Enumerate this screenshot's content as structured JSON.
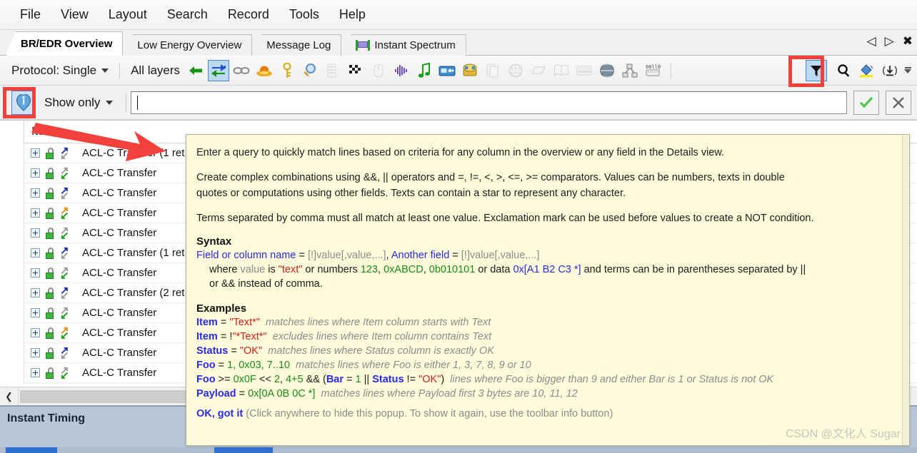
{
  "menu": {
    "items": [
      "File",
      "View",
      "Layout",
      "Search",
      "Record",
      "Tools",
      "Help"
    ]
  },
  "tabs": {
    "items": [
      {
        "label": "BR/EDR Overview",
        "active": true,
        "icon": ""
      },
      {
        "label": "Low Energy Overview",
        "active": false,
        "icon": ""
      },
      {
        "label": "Message Log",
        "active": false,
        "icon": ""
      },
      {
        "label": "Instant Spectrum",
        "active": false,
        "icon": "spectrum-icon"
      }
    ],
    "nav": {
      "prev": "◁",
      "next": "▷",
      "close": "✖"
    }
  },
  "toolbar": {
    "protocol_label": "Protocol: Single",
    "layers_label": "All layers",
    "icons": [
      {
        "name": "back-arrow-icon",
        "glyph": "←",
        "style": "green",
        "boxed": false,
        "dim": false
      },
      {
        "name": "bidirectional-arrow-icon",
        "glyph": "⇄",
        "style": "greenblue",
        "boxed": true,
        "dim": false
      },
      {
        "name": "link-chain-icon",
        "glyph": "⛓",
        "style": "gray",
        "boxed": false,
        "dim": false
      },
      {
        "name": "hat-icon",
        "glyph": "⬤",
        "style": "hat",
        "boxed": false,
        "dim": false
      },
      {
        "name": "key-icon",
        "glyph": "⚷",
        "style": "key",
        "boxed": false,
        "dim": false
      },
      {
        "name": "magnifier-icon",
        "glyph": "ὐd",
        "style": "magnifier",
        "boxed": false,
        "dim": false
      },
      {
        "name": "list-icon",
        "glyph": "☰",
        "style": "gray",
        "boxed": false,
        "dim": true
      },
      {
        "name": "checkered-flag-icon",
        "glyph": "⚑",
        "style": "flag",
        "boxed": false,
        "dim": false
      },
      {
        "name": "mouse-icon",
        "glyph": "⬭",
        "style": "gray",
        "boxed": false,
        "dim": true
      },
      {
        "name": "waveform-icon",
        "glyph": "✳",
        "style": "purple",
        "boxed": false,
        "dim": false
      },
      {
        "name": "music-note-icon",
        "glyph": "♫",
        "style": "greenmusic",
        "boxed": false,
        "dim": false
      },
      {
        "name": "radio-icon",
        "glyph": "▣",
        "style": "radio",
        "boxed": false,
        "dim": false
      },
      {
        "name": "phone-icon",
        "glyph": "☎",
        "style": "phone",
        "boxed": false,
        "dim": false
      },
      {
        "name": "copy-pages-icon",
        "glyph": "❐",
        "style": "gray",
        "boxed": false,
        "dim": true
      },
      {
        "name": "chip-icon",
        "glyph": "▦",
        "style": "gray",
        "boxed": false,
        "dim": true
      },
      {
        "name": "document-icon",
        "glyph": "▱",
        "style": "gray",
        "boxed": false,
        "dim": true
      },
      {
        "name": "book-icon",
        "glyph": "ὖe",
        "style": "gray",
        "boxed": false,
        "dim": true
      },
      {
        "name": "keyboard-icon",
        "glyph": "⌨",
        "style": "gray",
        "boxed": false,
        "dim": true
      },
      {
        "name": "globe-icon",
        "glyph": "ἱ0",
        "style": "globe",
        "boxed": false,
        "dim": false
      },
      {
        "name": "network-icon",
        "glyph": "⛭",
        "style": "gray",
        "boxed": false,
        "dim": false
      },
      {
        "name": "serial-port-icon",
        "glyph": "⌸",
        "style": "serial",
        "boxed": false,
        "dim": false
      }
    ],
    "right_icons": [
      {
        "name": "filter-funnel-icon",
        "glyph": "▽",
        "boxed": true
      },
      {
        "name": "search-icon",
        "glyph": "ὐd",
        "boxed": false
      },
      {
        "name": "paint-bucket-icon",
        "glyph": "◢",
        "boxed": false
      },
      {
        "name": "signal-download-icon",
        "glyph": "↓",
        "boxed": false
      }
    ]
  },
  "filterbar": {
    "info_icon": "info-circle-icon",
    "show_only_label": "Show only",
    "query_value": "",
    "query_placeholder": "",
    "apply_icon": "check-icon",
    "cancel_icon": "close-icon"
  },
  "tree": {
    "column_header": "Item",
    "rows": [
      {
        "label": "ACL-C Transfer (1 ret",
        "top": "blue",
        "bottom": "gray"
      },
      {
        "label": "ACL-C Transfer",
        "top": "gray",
        "bottom": "green"
      },
      {
        "label": "ACL-C Transfer",
        "top": "blue",
        "bottom": "gray"
      },
      {
        "label": "ACL-C Transfer",
        "top": "orange",
        "bottom": "green"
      },
      {
        "label": "ACL-C Transfer",
        "top": "gray",
        "bottom": "green"
      },
      {
        "label": "ACL-C Transfer (1 ret",
        "top": "blue",
        "bottom": "gray"
      },
      {
        "label": "ACL-C Transfer",
        "top": "gray",
        "bottom": "green"
      },
      {
        "label": "ACL-C Transfer (2 ret",
        "top": "blue",
        "bottom": "gray"
      },
      {
        "label": "ACL-C Transfer",
        "top": "gray",
        "bottom": "green"
      },
      {
        "label": "ACL-C Transfer",
        "top": "orange",
        "bottom": "green"
      },
      {
        "label": "ACL-C Transfer",
        "top": "blue",
        "bottom": "gray"
      },
      {
        "label": "ACL-C Transfer",
        "top": "gray",
        "bottom": "green"
      }
    ],
    "hscroll_left_icon": "chevron-left-icon"
  },
  "bottom_panel": {
    "title": "Instant Timing"
  },
  "popup": {
    "para1": "Enter a query to quickly match lines based on criteria for any column in the overview or any field in the Details view.",
    "para2a": "Create complex combinations using &&, || operators and =, !=, <, >, <=, >= comparators. Values can be numbers, texts in double",
    "para2b": "quotes or computations using other fields. Texts can contain a star to represent any character.",
    "para3": "Terms separated by comma must all match at least one value. Exclamation mark can be used before values to create a NOT condition.",
    "syntax_heading": "Syntax",
    "syntax": {
      "l1_field1": "Field or column name",
      "l1_eq1": " = ",
      "l1_val1": "[!]value[,value,...]",
      "l1_comma": ", ",
      "l1_field2": "Another field",
      "l1_eq2": " = ",
      "l1_val2": "[!]value[,value,...]",
      "l2_where": "where ",
      "l2_value": "value",
      "l2_is": " is ",
      "l2_text": "\"text\"",
      "l2_ornum": " or numbers ",
      "l2_n1": "123",
      "l2_c1": ", ",
      "l2_n2": "0xABCD",
      "l2_c2": ", ",
      "l2_n3": "0b010101",
      "l2_ordata": " or data ",
      "l2_data": "0x[A1 B2 C3 *]",
      "l2_tail": " and terms can be in parentheses separated by ||",
      "l3": "or && instead of comma."
    },
    "examples_heading": "Examples",
    "examples": [
      {
        "field": "Item",
        "op": " = ",
        "value": "\"Text*\"",
        "value_class": "red",
        "desc": "matches lines where Item column starts with Text"
      },
      {
        "field": "Item",
        "op": " = !",
        "value": "\"*Text*\"",
        "value_class": "red",
        "desc": "excludes lines where Item column contains Text"
      },
      {
        "field": "Status",
        "op": " = ",
        "value": "\"OK\"",
        "value_class": "red",
        "desc": "matches lines where Status column is exactly OK"
      },
      {
        "field": "Foo",
        "op": " = ",
        "value": "1, 0x03, 7..10",
        "value_class": "green",
        "desc": "matches lines where Foo is either 1, 3, 7, 8, 9 or 10"
      }
    ],
    "example5": {
      "field": "Foo",
      "op": " >= ",
      "v1": "0x0F",
      "mid1": " << ",
      "v2": "2",
      "mid2": ", ",
      "v3": "4+5",
      "mid3": " && (",
      "field2": "Bar",
      "op2": " = ",
      "v4": "1",
      "pipe": " || ",
      "field3": "Status",
      "op3": " != ",
      "v5": "\"OK\"",
      "close": ")",
      "desc": "lines where Foo is bigger than 9 and either Bar is 1 or Status is not OK"
    },
    "example6": {
      "field": "Payload",
      "op": " = ",
      "value": "0x[0A 0B 0C *]",
      "desc": "matches lines where Payload first 3 bytes are 10, 11, 12"
    },
    "ok_label": "OK, got it",
    "ok_hint": "(Click anywhere to hide this popup. To show it again, use the toolbar info button)",
    "watermark": "CSDN @文化人 Sugar"
  },
  "colors": {
    "accent_blue": "#2b2be0",
    "value_red": "#cc2020",
    "number_green": "#1a8a1a",
    "comment_gray": "#8c8c8c",
    "annotation_red": "#f2403d",
    "popup_bg": "#fdfbd9",
    "highlight_box": "#bcd9f4"
  }
}
